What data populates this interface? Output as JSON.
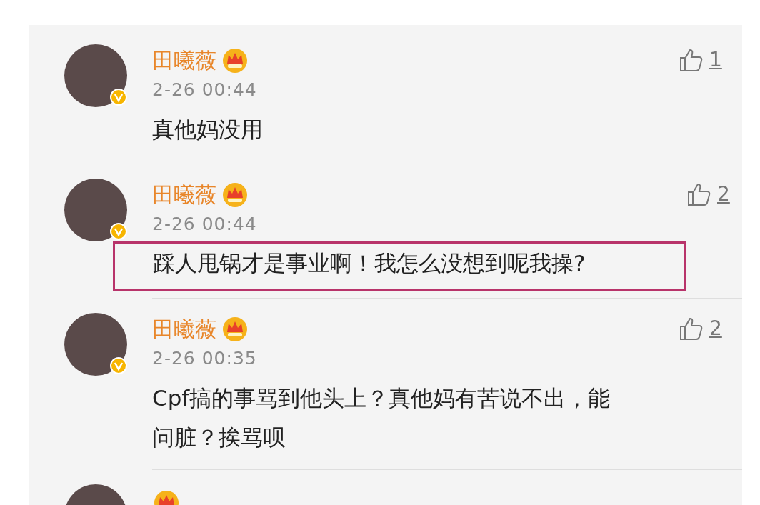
{
  "comments": [
    {
      "name": "田曦薇",
      "time": "2-26 00:44",
      "text": "真他妈没用",
      "likes": "1",
      "highlighted": false
    },
    {
      "name": "田曦薇",
      "time": "2-26 00:44",
      "text": "踩人甩锅才是事业啊！我怎么没想到呢我操?",
      "likes": "2",
      "highlighted": true
    },
    {
      "name": "田曦薇",
      "time": "2-26 00:35",
      "text": "Cpf搞的事骂到他头上？真他妈有苦说不出，能问脏？挨骂呗",
      "likes": "2",
      "highlighted": false
    },
    {
      "partial": true
    }
  ]
}
